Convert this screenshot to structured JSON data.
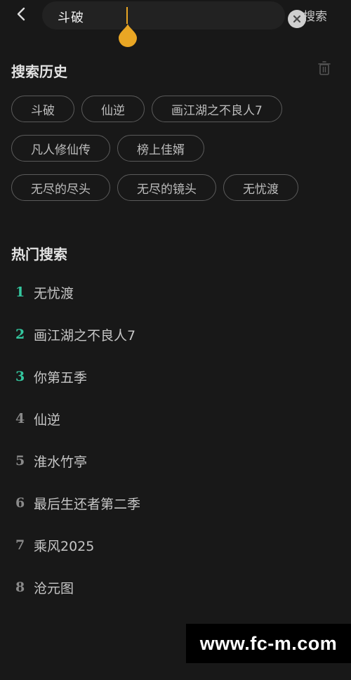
{
  "search": {
    "value": "斗破",
    "action_label": "搜索"
  },
  "history": {
    "title": "搜索历史",
    "rows": [
      [
        "斗破",
        "仙逆",
        "画江湖之不良人7"
      ],
      [
        "凡人修仙传",
        "榜上佳婿"
      ],
      [
        "无尽的尽头",
        "无尽的镜头",
        "无忧渡"
      ]
    ]
  },
  "hot": {
    "title": "热门搜索",
    "items": [
      {
        "rank": "1",
        "text": "无忧渡"
      },
      {
        "rank": "2",
        "text": "画江湖之不良人7"
      },
      {
        "rank": "3",
        "text": "你第五季"
      },
      {
        "rank": "4",
        "text": "仙逆"
      },
      {
        "rank": "5",
        "text": "淮水竹亭"
      },
      {
        "rank": "6",
        "text": "最后生还者第二季"
      },
      {
        "rank": "7",
        "text": "乘风2025"
      },
      {
        "rank": "8",
        "text": "沧元图"
      }
    ]
  },
  "watermark": "www.fc-m.com",
  "colors": {
    "background": "#181818",
    "accent_rank": "#34c79f",
    "cursor": "#e9a624"
  }
}
